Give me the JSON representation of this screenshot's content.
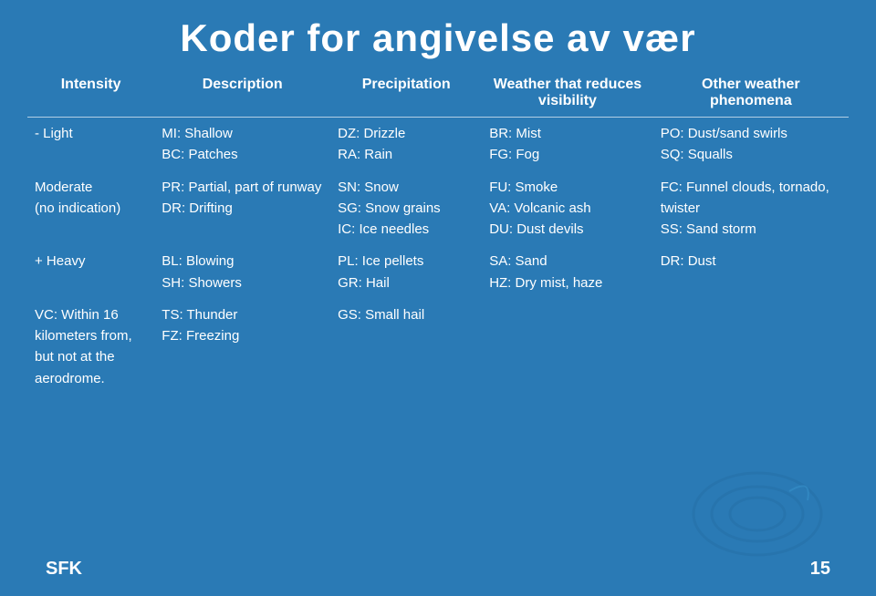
{
  "title": "Koder for angivelse av vær",
  "columns": {
    "intensity": "Intensity",
    "description": "Description",
    "precipitation": "Precipitation",
    "visibility": "Weather that reduces visibility",
    "other": "Other weather phenomena"
  },
  "rows": [
    {
      "intensity": "- Light",
      "description": "MI: Shallow\nBC: Patches",
      "precipitation": "DZ: Drizzle\nRA: Rain",
      "visibility": "BR: Mist\nFG: Fog",
      "other": "PO: Dust/sand swirls\nSQ: Squalls"
    },
    {
      "intensity": "Moderate\n(no indication)",
      "description": "PR: Partial, part of runway\nDR: Drifting",
      "precipitation": "SN: Snow\nSG: Snow grains\nIC: Ice needles",
      "visibility": "FU: Smoke\nVA: Volcanic ash\nDU: Dust devils",
      "other": "FC: Funnel clouds, tornado, twister\nSS: Sand storm"
    },
    {
      "intensity": "+ Heavy",
      "description": "BL: Blowing\nSH: Showers",
      "precipitation": "PL: Ice pellets\nGR: Hail",
      "visibility": "SA: Sand\nHZ: Dry mist, haze",
      "other": "DR: Dust"
    },
    {
      "intensity": "VC: Within 16 kilometers from, but not at the aerodrome.",
      "description": "TS: Thunder\nFZ: Freezing",
      "precipitation": "GS: Small hail",
      "visibility": "",
      "other": ""
    }
  ],
  "footer": {
    "left": "SFK",
    "right": "15"
  }
}
